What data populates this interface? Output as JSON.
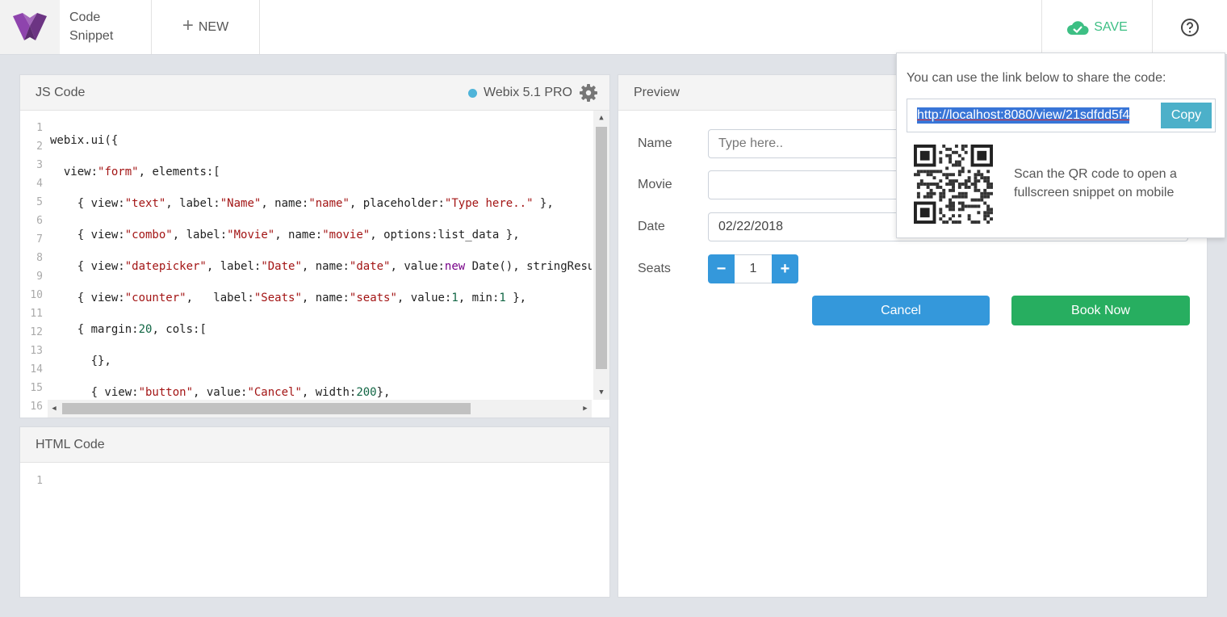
{
  "header": {
    "app_title_line1": "Code",
    "app_title_line2": "Snippet",
    "new_label": "NEW",
    "save_label": "SAVE",
    "accent_save": "#3dbf84"
  },
  "js_panel": {
    "title": "JS Code",
    "version": "Webix 5.1 PRO",
    "line_numbers": [
      "1",
      "2",
      "3",
      "4",
      "5",
      "6",
      "7",
      "8",
      "9",
      "10",
      "11",
      "12",
      "13",
      "14",
      "15",
      "16"
    ]
  },
  "html_panel": {
    "title": "HTML Code",
    "line_numbers": [
      "1"
    ]
  },
  "preview": {
    "title": "Preview",
    "name_label": "Name",
    "name_placeholder": "Type here..",
    "movie_label": "Movie",
    "movie_value": "",
    "date_label": "Date",
    "date_value": "02/22/2018",
    "seats_label": "Seats",
    "seats_value": "1",
    "cancel_label": "Cancel",
    "book_label": "Book Now",
    "colors": {
      "primary": "#3498db",
      "success": "#27ae60"
    }
  },
  "share_popup": {
    "message": "You can use the link below to share the code:",
    "link": "http://localhost:8080/view/21sdfdd5f4",
    "copy_label": "Copy",
    "qr_line1": "Scan the QR code to open a",
    "qr_line2": "fullscreen snippet on mobile"
  }
}
